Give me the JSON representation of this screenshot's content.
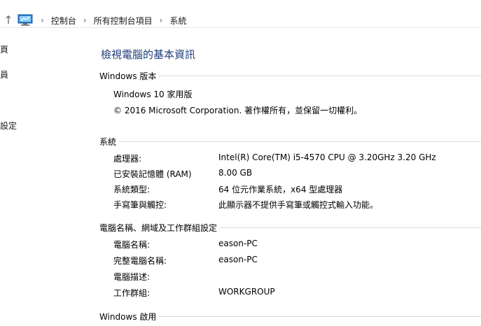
{
  "address_bar": {
    "crumbs": [
      "控制台",
      "所有控制台項目",
      "系統"
    ]
  },
  "left_nav": {
    "items": [
      "頁",
      "員",
      "設定"
    ]
  },
  "page_title": "檢視電腦的基本資訊",
  "windows_edition": {
    "heading": "Windows 版本",
    "edition": "Windows 10 家用版",
    "copyright": "© 2016 Microsoft Corporation. 著作權所有，並保留一切權利。"
  },
  "system": {
    "heading": "系統",
    "rows": [
      {
        "label": "處理器:",
        "value": "Intel(R) Core(TM) i5-4570 CPU @ 3.20GHz   3.20 GHz"
      },
      {
        "label": "已安裝記憶體 (RAM)",
        "value": "8.00 GB"
      },
      {
        "label": "系統類型:",
        "value": "64 位元作業系統，x64 型處理器"
      },
      {
        "label": "手寫筆與觸控:",
        "value": "此顯示器不提供手寫筆或觸控式輸入功能。"
      }
    ]
  },
  "computer_name": {
    "heading": "電腦名稱、網域及工作群組設定",
    "rows": [
      {
        "label": "電腦名稱:",
        "value": "eason-PC"
      },
      {
        "label": "完整電腦名稱:",
        "value": "eason-PC"
      },
      {
        "label": "電腦描述:",
        "value": ""
      },
      {
        "label": "工作群組:",
        "value": "WORKGROUP"
      }
    ]
  },
  "activation": {
    "heading": "Windows 啟用"
  },
  "colors": {
    "title": "#1e3c7a",
    "divider": "#d9d9d9"
  }
}
